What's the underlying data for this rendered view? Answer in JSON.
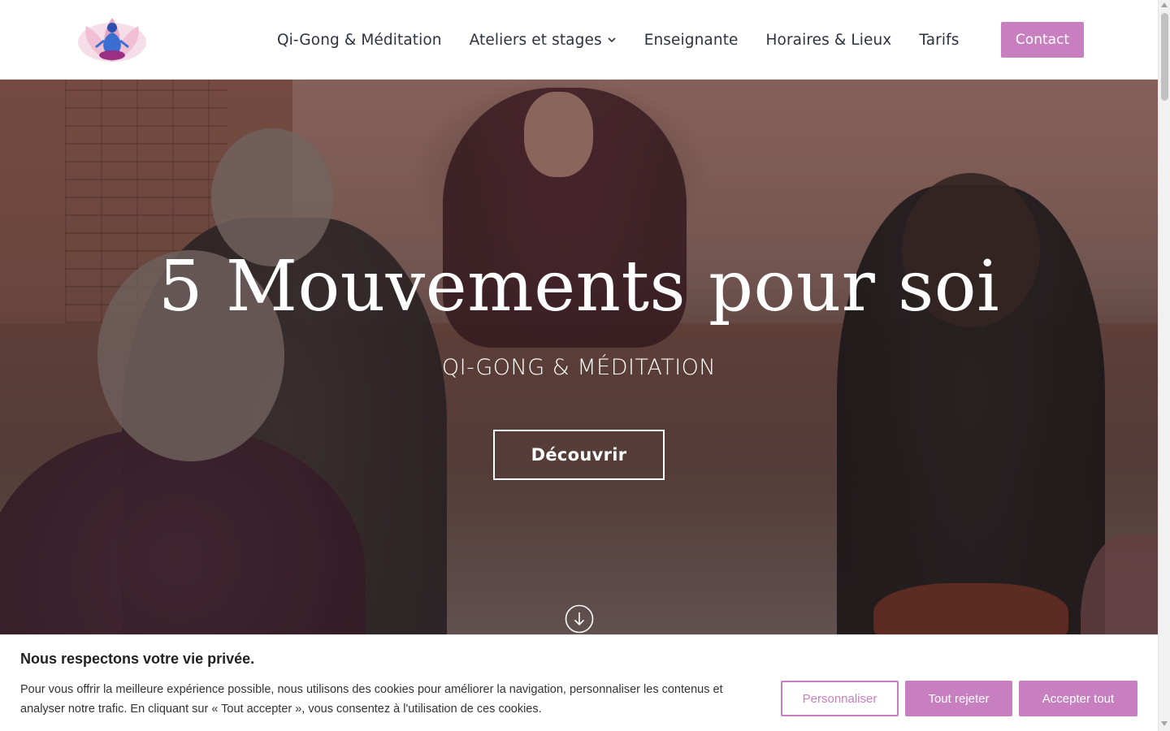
{
  "header": {
    "logo_icon": "lotus-meditation-logo",
    "nav": [
      {
        "label": "Qi-Gong & Méditation"
      },
      {
        "label": "Ateliers et stages",
        "has_dropdown": true
      },
      {
        "label": "Enseignante"
      },
      {
        "label": "Horaires & Lieux"
      },
      {
        "label": "Tarifs"
      }
    ],
    "contact_label": "Contact"
  },
  "hero": {
    "title": "5 Mouvements pour soi",
    "subtitle": "QI-GONG & MÉDITATION",
    "cta_label": "Découvrir",
    "scroll_icon": "arrow-down-circle-icon"
  },
  "cookie": {
    "title": "Nous respectons votre vie privée.",
    "text": "Pour vous offrir la meilleure expérience possible, nous utilisons des cookies pour améliorer la navigation, personnaliser les contenus et analyser notre trafic. En cliquant sur « Tout accepter », vous consentez à l'utilisation de ces cookies.",
    "customize_label": "Personnaliser",
    "reject_label": "Tout rejeter",
    "accept_label": "Accepter tout"
  },
  "colors": {
    "accent": "#c77fbf",
    "nav_text": "#2f3340"
  }
}
